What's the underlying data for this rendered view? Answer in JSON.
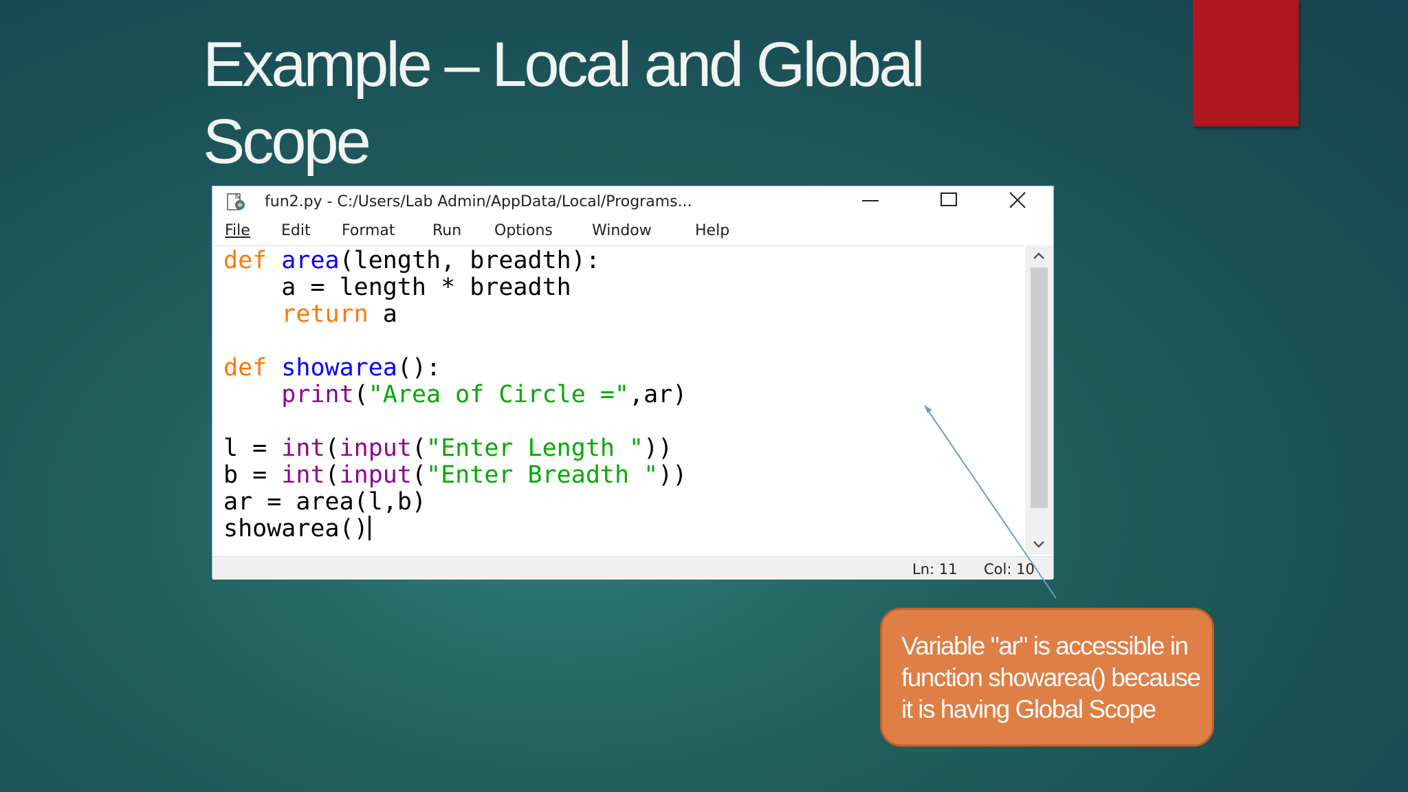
{
  "slide": {
    "title": "Example – Local and Global Scope",
    "callout": "Variable \"ar\" is accessible in function showarea() because it is having Global Scope",
    "colors": {
      "background": "#1f5a5c",
      "accent_bar": "#b0161d",
      "callout_fill": "#df7e45",
      "connector": "#6f9cc4"
    }
  },
  "window": {
    "title": "fun2.py - C:/Users/Lab Admin/AppData/Local/Programs...",
    "app_icon": "python-file-icon",
    "controls": [
      "minimize-icon",
      "maximize-icon",
      "close-icon"
    ],
    "menu": [
      "File",
      "Edit",
      "Format",
      "Run",
      "Options",
      "Window",
      "Help"
    ],
    "status": {
      "line": "Ln: 11",
      "col": "Col: 10"
    }
  },
  "code": {
    "language": "python",
    "lines": [
      "def area(length, breadth):",
      "    a = length * breadth",
      "    return a",
      "",
      "def showarea():",
      "    print(\"Area of Circle =\",ar)",
      "",
      "l = int(input(\"Enter Length \"))",
      "b = int(input(\"Enter Breadth \"))",
      "ar = area(l,b)",
      "showarea()"
    ],
    "syntax_colors": {
      "keyword": "#ff7700",
      "definition": "#0000ff",
      "builtin": "#900090",
      "string": "#00aa00"
    }
  }
}
